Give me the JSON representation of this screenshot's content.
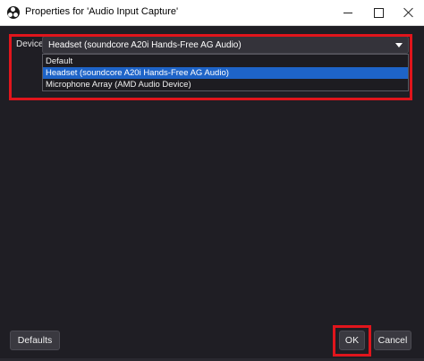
{
  "window": {
    "title": "Properties for 'Audio Input Capture'",
    "app_icon": "obs-logo-icon"
  },
  "device": {
    "label": "Device",
    "selected": "Headset (soundcore A20i Hands-Free AG Audio)",
    "options": [
      "Default",
      "Headset (soundcore A20i Hands-Free AG Audio)",
      "Microphone Array (AMD Audio Device)"
    ],
    "highlighted_index": 1
  },
  "buttons": {
    "defaults": "Defaults",
    "ok": "OK",
    "cancel": "Cancel"
  },
  "colors": {
    "background": "#1f1e24",
    "selection": "#1e64c8",
    "annotation_red": "#e0151c"
  }
}
